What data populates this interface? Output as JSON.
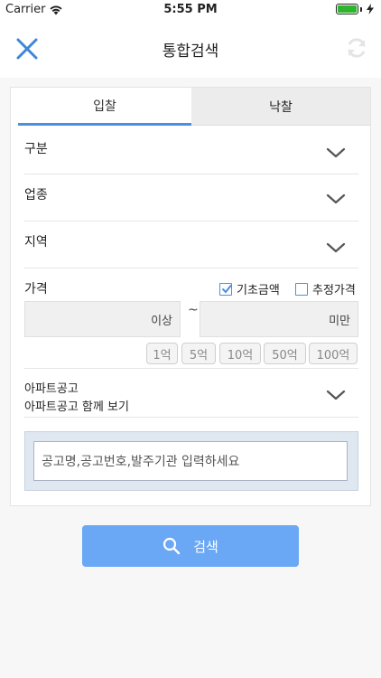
{
  "status": {
    "carrier": "Carrier",
    "time": "5:55 PM"
  },
  "header": {
    "title": "통합검색"
  },
  "tabs": [
    {
      "label": "입찰"
    },
    {
      "label": "낙찰"
    }
  ],
  "filters": {
    "category": "구분",
    "industry": "업종",
    "region": "지역"
  },
  "price": {
    "label": "가격",
    "base_price_label": "기초금액",
    "estimated_price_label": "추정가격",
    "min_suffix": "이상",
    "range_separator": "~",
    "max_suffix": "미만",
    "quick_amounts": [
      "1억",
      "5억",
      "10억",
      "50억",
      "100억"
    ]
  },
  "apartment": {
    "title": "아파트공고",
    "subtitle": "아파트공고 함께 보기"
  },
  "search": {
    "placeholder": "공고명,공고번호,발주기관 입력하세요",
    "button_label": "검색"
  },
  "colors": {
    "accent": "#4a90e2",
    "search_button": "#6aa7f5"
  }
}
